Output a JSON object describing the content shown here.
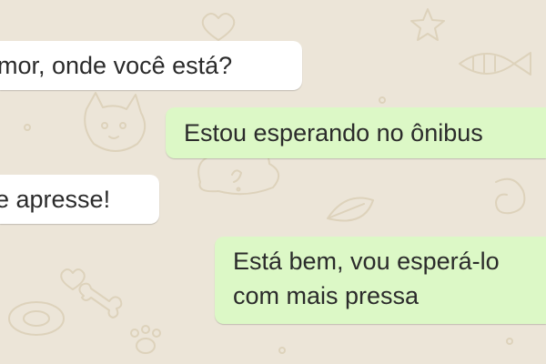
{
  "conversation": {
    "messages": [
      {
        "direction": "incoming",
        "text": "mor, onde você está?"
      },
      {
        "direction": "outgoing",
        "text": "Estou esperando no ônibus"
      },
      {
        "direction": "incoming",
        "text": "e apresse!"
      },
      {
        "direction": "outgoing",
        "text": "Está bem, vou esperá-lo\ncom mais pressa"
      }
    ]
  },
  "colors": {
    "wallpaper": "#ece5d8",
    "wallpaper_doodle": "#ddd2bb",
    "incoming_bubble": "#ffffff",
    "outgoing_bubble": "#dcf8c6",
    "text": "#2b2b2b"
  }
}
